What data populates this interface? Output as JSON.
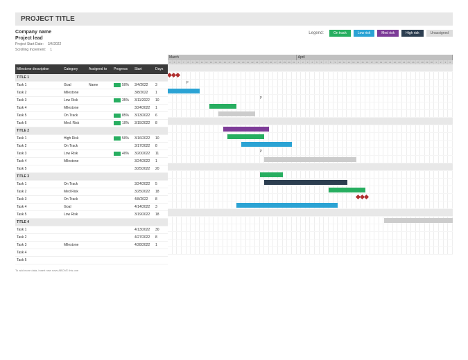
{
  "title": "PROJECT TITLE",
  "meta": {
    "company_label": "Company name",
    "lead_label": "Project lead",
    "start_label": "Project Start Date:",
    "start_value": "3/4/2022",
    "scroll_label": "Scrolling Increment:",
    "scroll_value": "1"
  },
  "legend": {
    "label": "Legend:",
    "ontrack": "On track",
    "lowrisk": "Low risk",
    "medrisk": "Med risk",
    "highrisk": "High risk",
    "unassigned": "Unassigned"
  },
  "columns": {
    "desc": "Milestone description",
    "cat": "Category",
    "asn": "Assigned to",
    "prog": "Progress",
    "start": "Start",
    "days": "Days"
  },
  "months": [
    {
      "name": "March",
      "span": 28
    },
    {
      "name": "April",
      "span": 34
    }
  ],
  "days": [
    4,
    5,
    6,
    7,
    8,
    9,
    10,
    11,
    12,
    13,
    14,
    15,
    16,
    17,
    18,
    19,
    20,
    21,
    22,
    23,
    24,
    25,
    26,
    27,
    28,
    29,
    30,
    31,
    1,
    2,
    3,
    4,
    5,
    6,
    7,
    8,
    9,
    10,
    11,
    12,
    13,
    14,
    15,
    16,
    17,
    18,
    19,
    20,
    21,
    22,
    23,
    24,
    25,
    26,
    27,
    28,
    29,
    30,
    1,
    2,
    3,
    4
  ],
  "rows": [
    {
      "type": "section",
      "desc": "TITLE 1"
    },
    {
      "type": "task",
      "desc": "Task 1",
      "cat": "Goal",
      "asn": "Name",
      "prog": "50%",
      "start": "3/4/2022",
      "days": "3",
      "bar": {
        "day": 0,
        "len": 3,
        "style": "goal"
      }
    },
    {
      "type": "task",
      "desc": "Task 2",
      "cat": "Milestone",
      "asn": "",
      "prog": "",
      "start": "3/8/2022",
      "days": "1",
      "bar": {
        "day": 4,
        "len": 1,
        "style": "milestone"
      }
    },
    {
      "type": "task",
      "desc": "Task 3",
      "cat": "Low Risk",
      "asn": "",
      "prog": "35%",
      "start": "3/11/2022",
      "days": "10",
      "bar": {
        "day": 0,
        "len": 7,
        "style": "lowrisk"
      }
    },
    {
      "type": "task",
      "desc": "Task 4",
      "cat": "Milestone",
      "asn": "",
      "prog": "",
      "start": "3/24/2022",
      "days": "1",
      "bar": {
        "day": 20,
        "len": 1,
        "style": "milestone"
      }
    },
    {
      "type": "task",
      "desc": "Task 5",
      "cat": "On Track",
      "asn": "",
      "prog": "85%",
      "start": "3/13/2022",
      "days": "6",
      "bar": {
        "day": 9,
        "len": 6,
        "style": "ontrack"
      }
    },
    {
      "type": "task",
      "desc": "Task 6",
      "cat": "Med. Risk",
      "asn": "",
      "prog": "10%",
      "start": "3/15/2022",
      "days": "8",
      "bar": {
        "day": 11,
        "len": 8,
        "style": "unassigned"
      }
    },
    {
      "type": "section",
      "desc": "TITLE 2"
    },
    {
      "type": "task",
      "desc": "Task 1",
      "cat": "High Risk",
      "asn": "",
      "prog": "50%",
      "start": "3/16/2022",
      "days": "10",
      "bar": {
        "day": 12,
        "len": 10,
        "style": "medrisk"
      }
    },
    {
      "type": "task",
      "desc": "Task 2",
      "cat": "On Track",
      "asn": "",
      "prog": "",
      "start": "3/17/2022",
      "days": "8",
      "bar": {
        "day": 13,
        "len": 8,
        "style": "ontrack"
      }
    },
    {
      "type": "task",
      "desc": "Task 3",
      "cat": "Low Risk",
      "asn": "",
      "prog": "40%",
      "start": "3/20/2022",
      "days": "11",
      "bar": {
        "day": 16,
        "len": 11,
        "style": "lowrisk"
      }
    },
    {
      "type": "task",
      "desc": "Task 4",
      "cat": "Milestone",
      "asn": "",
      "prog": "",
      "start": "3/24/2022",
      "days": "1",
      "bar": {
        "day": 20,
        "len": 1,
        "style": "milestone"
      }
    },
    {
      "type": "task",
      "desc": "Task 5",
      "cat": "",
      "asn": "",
      "prog": "",
      "start": "3/25/2022",
      "days": "20",
      "bar": {
        "day": 21,
        "len": 20,
        "style": "unassigned"
      }
    },
    {
      "type": "section",
      "desc": "TITLE 3"
    },
    {
      "type": "task",
      "desc": "Task 1",
      "cat": "On Track",
      "asn": "",
      "prog": "",
      "start": "3/24/2022",
      "days": "5",
      "bar": {
        "day": 20,
        "len": 5,
        "style": "ontrack"
      }
    },
    {
      "type": "task",
      "desc": "Task 2",
      "cat": "Med Risk",
      "asn": "",
      "prog": "",
      "start": "3/25/2022",
      "days": "18",
      "bar": {
        "day": 21,
        "len": 18,
        "style": "highrisk"
      }
    },
    {
      "type": "task",
      "desc": "Task 3",
      "cat": "On Track",
      "asn": "",
      "prog": "",
      "start": "4/8/2022",
      "days": "8",
      "bar": {
        "day": 35,
        "len": 8,
        "style": "ontrack"
      }
    },
    {
      "type": "task",
      "desc": "Task 4",
      "cat": "Goal",
      "asn": "",
      "prog": "",
      "start": "4/14/2022",
      "days": "3",
      "bar": {
        "day": 41,
        "len": 3,
        "style": "goal"
      }
    },
    {
      "type": "task",
      "desc": "Task 5",
      "cat": "Low Risk",
      "asn": "",
      "prog": "",
      "start": "3/19/2022",
      "days": "18",
      "bar": {
        "day": 15,
        "len": 22,
        "style": "lowrisk"
      }
    },
    {
      "type": "section",
      "desc": "TITLE 4"
    },
    {
      "type": "task",
      "desc": "Task 1",
      "cat": "",
      "asn": "",
      "prog": "",
      "start": "4/13/2022",
      "days": "30",
      "bar": {
        "day": 47,
        "len": 20,
        "style": "unassigned"
      }
    },
    {
      "type": "task",
      "desc": "Task 2",
      "cat": "",
      "asn": "",
      "prog": "",
      "start": "4/27/2022",
      "days": "8",
      "bar": null
    },
    {
      "type": "task",
      "desc": "Task 3",
      "cat": "Milestone",
      "asn": "",
      "prog": "",
      "start": "4/28/2022",
      "days": "1",
      "bar": null
    },
    {
      "type": "task",
      "desc": "Task 4",
      "cat": "",
      "asn": "",
      "prog": "",
      "start": "",
      "days": "",
      "bar": null
    },
    {
      "type": "task",
      "desc": "Task 5",
      "cat": "",
      "asn": "",
      "prog": "",
      "start": "",
      "days": "",
      "bar": null
    }
  ],
  "footnote": "To add more data, Insert new rows ABOVE this one",
  "chart_data": {
    "type": "gantt",
    "title": "PROJECT TITLE",
    "x_axis": "Date",
    "x_range": [
      "2022-03-04",
      "2022-05-04"
    ],
    "categories": [
      "On track",
      "Low risk",
      "Med risk",
      "High risk",
      "Unassigned",
      "Goal",
      "Milestone"
    ],
    "series": [
      {
        "group": "TITLE 1",
        "task": "Task 1",
        "category": "Goal",
        "assigned": "Name",
        "progress": 50,
        "start": "2022-03-04",
        "days": 3
      },
      {
        "group": "TITLE 1",
        "task": "Task 2",
        "category": "Milestone",
        "progress": null,
        "start": "2022-03-08",
        "days": 1
      },
      {
        "group": "TITLE 1",
        "task": "Task 3",
        "category": "Low Risk",
        "progress": 35,
        "start": "2022-03-11",
        "days": 10
      },
      {
        "group": "TITLE 1",
        "task": "Task 4",
        "category": "Milestone",
        "progress": null,
        "start": "2022-03-24",
        "days": 1
      },
      {
        "group": "TITLE 1",
        "task": "Task 5",
        "category": "On Track",
        "progress": 85,
        "start": "2022-03-13",
        "days": 6
      },
      {
        "group": "TITLE 1",
        "task": "Task 6",
        "category": "Med. Risk",
        "progress": 10,
        "start": "2022-03-15",
        "days": 8
      },
      {
        "group": "TITLE 2",
        "task": "Task 1",
        "category": "High Risk",
        "progress": 50,
        "start": "2022-03-16",
        "days": 10
      },
      {
        "group": "TITLE 2",
        "task": "Task 2",
        "category": "On Track",
        "progress": null,
        "start": "2022-03-17",
        "days": 8
      },
      {
        "group": "TITLE 2",
        "task": "Task 3",
        "category": "Low Risk",
        "progress": 40,
        "start": "2022-03-20",
        "days": 11
      },
      {
        "group": "TITLE 2",
        "task": "Task 4",
        "category": "Milestone",
        "progress": null,
        "start": "2022-03-24",
        "days": 1
      },
      {
        "group": "TITLE 2",
        "task": "Task 5",
        "category": "Unassigned",
        "progress": null,
        "start": "2022-03-25",
        "days": 20
      },
      {
        "group": "TITLE 3",
        "task": "Task 1",
        "category": "On Track",
        "progress": null,
        "start": "2022-03-24",
        "days": 5
      },
      {
        "group": "TITLE 3",
        "task": "Task 2",
        "category": "Med Risk",
        "progress": null,
        "start": "2022-03-25",
        "days": 18
      },
      {
        "group": "TITLE 3",
        "task": "Task 3",
        "category": "On Track",
        "progress": null,
        "start": "2022-04-08",
        "days": 8
      },
      {
        "group": "TITLE 3",
        "task": "Task 4",
        "category": "Goal",
        "progress": null,
        "start": "2022-04-14",
        "days": 3
      },
      {
        "group": "TITLE 3",
        "task": "Task 5",
        "category": "Low Risk",
        "progress": null,
        "start": "2022-03-19",
        "days": 18
      },
      {
        "group": "TITLE 4",
        "task": "Task 1",
        "category": "Unassigned",
        "progress": null,
        "start": "2022-04-13",
        "days": 30
      },
      {
        "group": "TITLE 4",
        "task": "Task 2",
        "category": "Unassigned",
        "progress": null,
        "start": "2022-04-27",
        "days": 8
      },
      {
        "group": "TITLE 4",
        "task": "Task 3",
        "category": "Milestone",
        "progress": null,
        "start": "2022-04-28",
        "days": 1
      }
    ]
  }
}
